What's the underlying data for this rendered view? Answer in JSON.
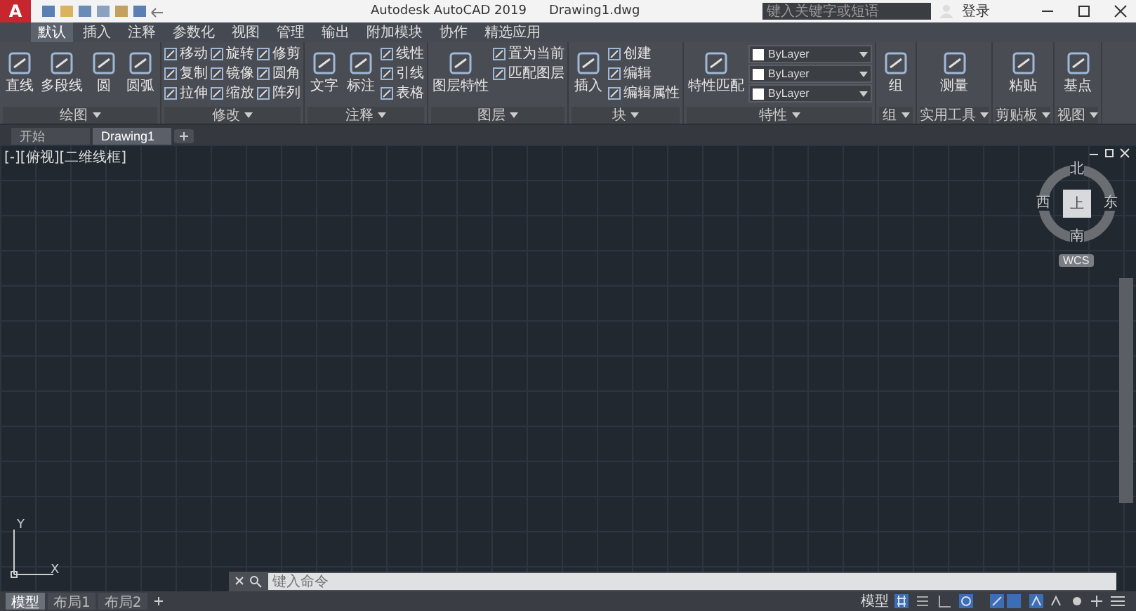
{
  "title_bar": {
    "app_button": "A",
    "title": "Autodesk AutoCAD 2019",
    "document": "Drawing1.dwg",
    "search": {
      "placeholder": "键入关键字或短语"
    },
    "sign_in": "登录"
  },
  "ribbon_tabs": [
    {
      "label": "默认",
      "selected": true
    },
    {
      "label": "插入",
      "selected": false
    },
    {
      "label": "注释",
      "selected": false
    },
    {
      "label": "参数化",
      "selected": false
    },
    {
      "label": "视图",
      "selected": false
    },
    {
      "label": "管理",
      "selected": false
    },
    {
      "label": "输出",
      "selected": false
    },
    {
      "label": "附加模块",
      "selected": false
    },
    {
      "label": "协作",
      "selected": false
    },
    {
      "label": "精选应用",
      "selected": false
    }
  ],
  "ribbon_panels": [
    {
      "title": "绘图",
      "items": [
        {
          "kind": "large",
          "label": "直线"
        },
        {
          "kind": "large",
          "label": "多段线"
        },
        {
          "kind": "large",
          "label": "圆"
        },
        {
          "kind": "large",
          "label": "圆弧"
        }
      ]
    },
    {
      "title": "修改",
      "items": [
        {
          "kind": "small",
          "label": "移动"
        },
        {
          "kind": "small",
          "label": "复制"
        },
        {
          "kind": "small",
          "label": "拉伸"
        },
        {
          "kind": "small",
          "label": "旋转"
        },
        {
          "kind": "small",
          "label": "镜像"
        },
        {
          "kind": "small",
          "label": "缩放"
        },
        {
          "kind": "small",
          "label": "修剪"
        },
        {
          "kind": "small",
          "label": "圆角"
        },
        {
          "kind": "small",
          "label": "阵列"
        }
      ]
    },
    {
      "title": "注释",
      "items": [
        {
          "kind": "large",
          "label": "文字"
        },
        {
          "kind": "large",
          "label": "标注"
        },
        {
          "kind": "small",
          "label": "线性"
        },
        {
          "kind": "small",
          "label": "引线"
        },
        {
          "kind": "small",
          "label": "表格"
        }
      ]
    },
    {
      "title": "图层",
      "items": [
        {
          "kind": "large",
          "label": "图层特性"
        },
        {
          "kind": "small",
          "label": "置为当前"
        },
        {
          "kind": "small",
          "label": "匹配图层"
        }
      ]
    },
    {
      "title": "块",
      "items": [
        {
          "kind": "large",
          "label": "插入"
        },
        {
          "kind": "small",
          "label": "创建"
        },
        {
          "kind": "small",
          "label": "编辑"
        },
        {
          "kind": "small",
          "label": "编辑属性"
        }
      ]
    },
    {
      "title": "特性",
      "items": [
        {
          "kind": "large",
          "label": "特性匹配"
        },
        {
          "kind": "dropdown",
          "label": "ByLayer"
        },
        {
          "kind": "dropdown",
          "label": "ByLayer"
        },
        {
          "kind": "dropdown",
          "label": "ByLayer"
        }
      ]
    },
    {
      "title": "组",
      "items": [
        {
          "kind": "large",
          "label": "组"
        }
      ]
    },
    {
      "title": "实用工具",
      "items": [
        {
          "kind": "large",
          "label": "测量"
        }
      ]
    },
    {
      "title": "剪贴板",
      "items": [
        {
          "kind": "large",
          "label": "粘贴"
        }
      ]
    },
    {
      "title": "视图",
      "items": [
        {
          "kind": "large",
          "label": "基点"
        }
      ]
    }
  ],
  "document_tabs": [
    {
      "label": "开始",
      "selected": false
    },
    {
      "label": "Drawing1",
      "selected": true
    }
  ],
  "viewport": {
    "label": "[-][俯视][二维线框]",
    "viewcube": {
      "north": "北",
      "east": "东",
      "south": "南",
      "west": "西",
      "face": "上",
      "coordinate_system": "WCS"
    },
    "ucs": {
      "y": "Y",
      "x": "X"
    }
  },
  "command_line": {
    "placeholder": "键入命令"
  },
  "layout_tabs": [
    {
      "label": "模型",
      "selected": true
    },
    {
      "label": "布局1",
      "selected": false
    },
    {
      "label": "布局2",
      "selected": false
    }
  ],
  "status_bar": {
    "mode": "模型"
  }
}
